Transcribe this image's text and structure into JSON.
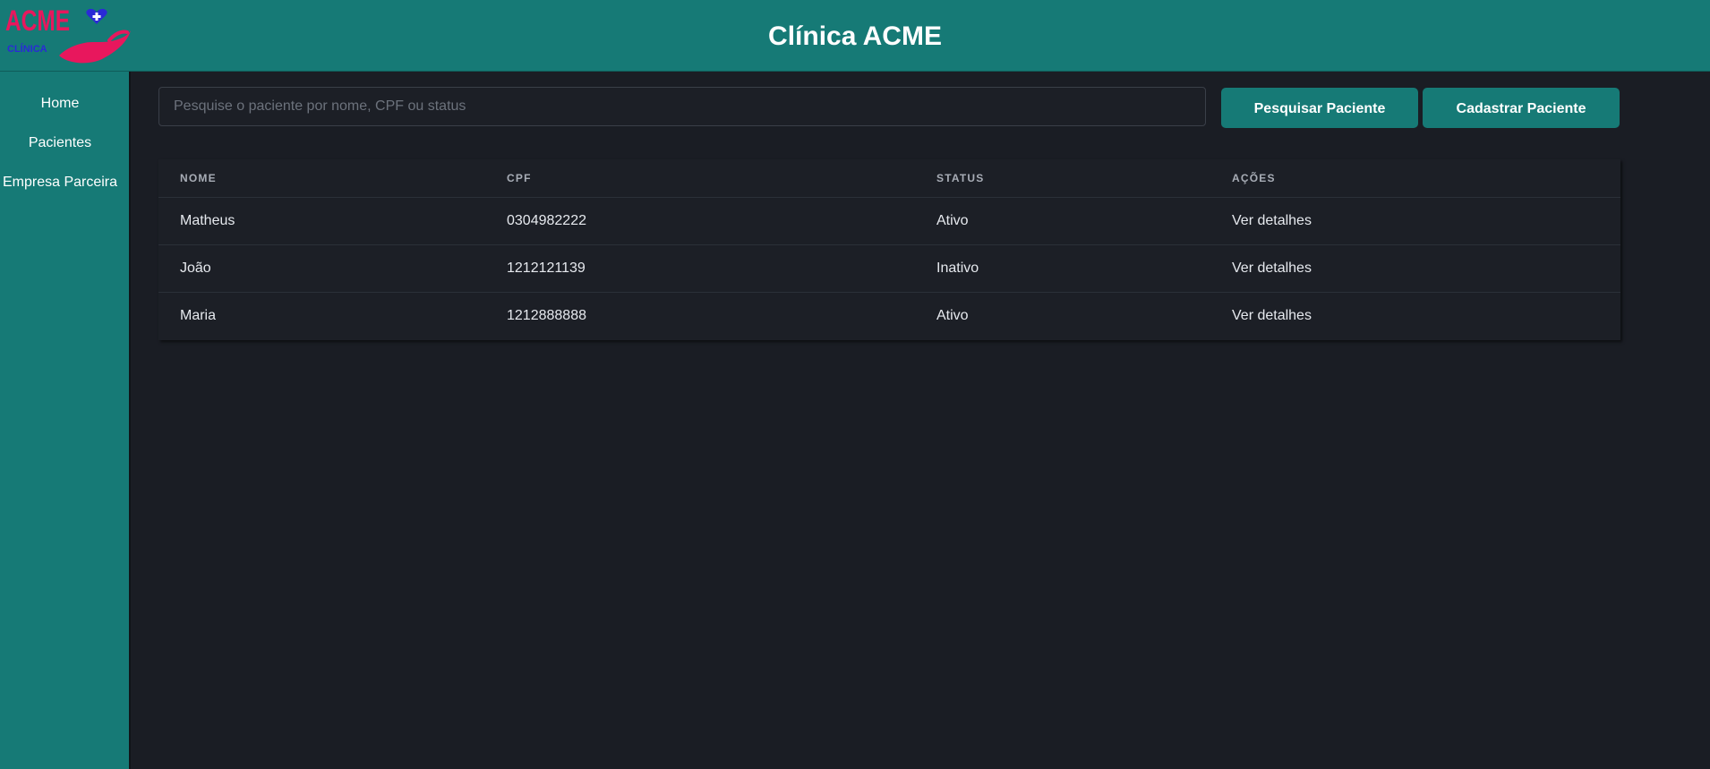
{
  "app": {
    "title": "Clínica ACME",
    "logo_text": "ACME",
    "logo_subtext": "CLÍNICA"
  },
  "sidebar": {
    "items": [
      {
        "label": "Home"
      },
      {
        "label": "Pacientes"
      },
      {
        "label": "Empresa Parceira"
      }
    ]
  },
  "search": {
    "placeholder": "Pesquise o paciente por nome, CPF ou status",
    "value": ""
  },
  "toolbar": {
    "search_button_label": "Pesquisar Paciente",
    "register_button_label": "Cadastrar Paciente"
  },
  "table": {
    "headers": {
      "nome": "NOME",
      "cpf": "CPF",
      "status": "STATUS",
      "acoes": "AÇÕES"
    },
    "rows": [
      {
        "nome": "Matheus",
        "cpf": "0304982222",
        "status": "Ativo",
        "acao": "Ver detalhes"
      },
      {
        "nome": "João",
        "cpf": "1212121139",
        "status": "Inativo",
        "acao": "Ver detalhes"
      },
      {
        "nome": "Maria",
        "cpf": "1212888888",
        "status": "Ativo",
        "acao": "Ver detalhes"
      }
    ]
  },
  "colors": {
    "brand_teal": "#167a76",
    "background": "#1a1d24",
    "logo_pink": "#e8175d",
    "logo_blue": "#2a2ad6"
  },
  "icons": {
    "logo": "heart-hand-logo-icon"
  }
}
